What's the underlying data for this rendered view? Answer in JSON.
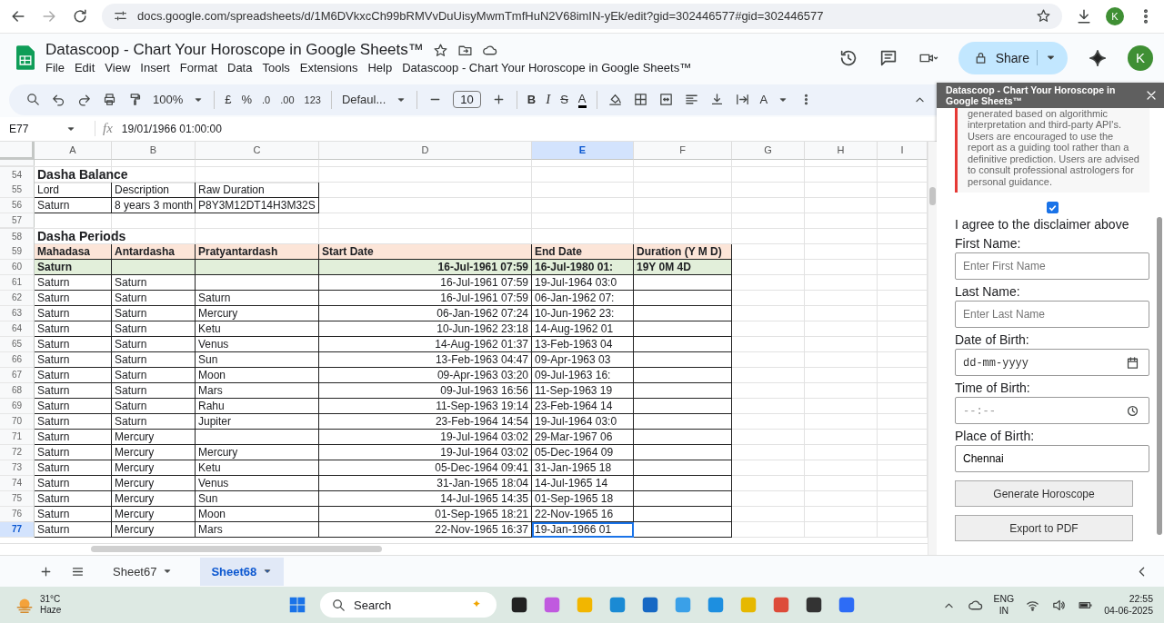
{
  "browser": {
    "url": "docs.google.com/spreadsheets/d/1M6DVkxcCh99bRMVvDuUisyMwmTmfHuN2V68imIN-yEk/edit?gid=302446577#gid=302446577",
    "avatar": "K"
  },
  "header": {
    "title": "Datascoop - Chart Your Horoscope in Google Sheets™",
    "menu": [
      "File",
      "Edit",
      "View",
      "Insert",
      "Format",
      "Data",
      "Tools",
      "Extensions",
      "Help",
      "Datascoop - Chart Your Horoscope in Google Sheets™"
    ],
    "share": "Share",
    "avatar": "K"
  },
  "toolbar": {
    "zoom": "100%",
    "currency": "£",
    "percent": "%",
    "decrease_decimal": ".0",
    "increase_decimal": ".00",
    "number_format": "123",
    "font": "Defaul...",
    "font_size": "10",
    "bold": "B",
    "italic": "I",
    "strikethrough": "S",
    "text_color": "A",
    "text_rotation": "A"
  },
  "formula_bar": {
    "cell": "E77",
    "function_label": "fx",
    "value": "19/01/1966 01:00:00"
  },
  "sheet": {
    "columns": [
      {
        "label": "A",
        "selected": false
      },
      {
        "label": "B",
        "selected": false
      },
      {
        "label": "C",
        "selected": false
      },
      {
        "label": "D",
        "selected": false
      },
      {
        "label": "E",
        "selected": true
      },
      {
        "label": "F",
        "selected": false
      },
      {
        "label": "G",
        "selected": false
      },
      {
        "label": "H",
        "selected": false
      },
      {
        "label": "I",
        "selected": false
      }
    ],
    "rows": [
      {
        "number": "54",
        "kind": "title",
        "selected": false,
        "cells": [
          "Dasha Balance"
        ]
      },
      {
        "number": "55",
        "kind": "balance",
        "selected": false,
        "cells": [
          "Lord",
          "Description",
          "Raw Duration"
        ]
      },
      {
        "number": "56",
        "kind": "balance",
        "selected": false,
        "cells": [
          "Saturn",
          "8 years 3 month",
          "P8Y3M12DT14H3M32S"
        ]
      },
      {
        "number": "57",
        "kind": "empty",
        "selected": false,
        "cells": []
      },
      {
        "number": "58",
        "kind": "title",
        "selected": false,
        "cells": [
          "Dasha Periods"
        ]
      },
      {
        "number": "59",
        "kind": "table-header",
        "selected": false,
        "cells": [
          "Mahadasa",
          "Antardasha",
          "Pratyantardash",
          "Start Date",
          "End Date",
          "Duration (Y M D)"
        ]
      },
      {
        "number": "60",
        "kind": "mahadasa",
        "selected": false,
        "cells": [
          "Saturn",
          null,
          null,
          "16-Jul-1961 07:59",
          "16-Jul-1980 01:",
          "19Y 0M 4D"
        ]
      },
      {
        "number": "61",
        "kind": "period",
        "selected": false,
        "cells": [
          "Saturn",
          "Saturn",
          null,
          "16-Jul-1961 07:59",
          "19-Jul-1964 03:0"
        ]
      },
      {
        "number": "62",
        "kind": "period",
        "selected": false,
        "cells": [
          "Saturn",
          "Saturn",
          "Saturn",
          "16-Jul-1961 07:59",
          "06-Jan-1962 07:"
        ]
      },
      {
        "number": "63",
        "kind": "period",
        "selected": false,
        "cells": [
          "Saturn",
          "Saturn",
          "Mercury",
          "06-Jan-1962 07:24",
          "10-Jun-1962 23:"
        ]
      },
      {
        "number": "64",
        "kind": "period",
        "selected": false,
        "cells": [
          "Saturn",
          "Saturn",
          "Ketu",
          "10-Jun-1962 23:18",
          "14-Aug-1962 01"
        ]
      },
      {
        "number": "65",
        "kind": "period",
        "selected": false,
        "cells": [
          "Saturn",
          "Saturn",
          "Venus",
          "14-Aug-1962 01:37",
          "13-Feb-1963 04"
        ]
      },
      {
        "number": "66",
        "kind": "period",
        "selected": false,
        "cells": [
          "Saturn",
          "Saturn",
          "Sun",
          "13-Feb-1963 04:47",
          "09-Apr-1963 03"
        ]
      },
      {
        "number": "67",
        "kind": "period",
        "selected": false,
        "cells": [
          "Saturn",
          "Saturn",
          "Moon",
          "09-Apr-1963 03:20",
          "09-Jul-1963 16:"
        ]
      },
      {
        "number": "68",
        "kind": "period",
        "selected": false,
        "cells": [
          "Saturn",
          "Saturn",
          "Mars",
          "09-Jul-1963 16:56",
          "11-Sep-1963 19"
        ]
      },
      {
        "number": "69",
        "kind": "period",
        "selected": false,
        "cells": [
          "Saturn",
          "Saturn",
          "Rahu",
          "11-Sep-1963 19:14",
          "23-Feb-1964 14"
        ]
      },
      {
        "number": "70",
        "kind": "period",
        "selected": false,
        "cells": [
          "Saturn",
          "Saturn",
          "Jupiter",
          "23-Feb-1964 14:54",
          "19-Jul-1964 03:0"
        ]
      },
      {
        "number": "71",
        "kind": "period",
        "selected": false,
        "cells": [
          "Saturn",
          "Mercury",
          null,
          "19-Jul-1964 03:02",
          "29-Mar-1967 06"
        ]
      },
      {
        "number": "72",
        "kind": "period",
        "selected": false,
        "cells": [
          "Saturn",
          "Mercury",
          "Mercury",
          "19-Jul-1964 03:02",
          "05-Dec-1964 09"
        ]
      },
      {
        "number": "73",
        "kind": "period",
        "selected": false,
        "cells": [
          "Saturn",
          "Mercury",
          "Ketu",
          "05-Dec-1964 09:41",
          "31-Jan-1965 18"
        ]
      },
      {
        "number": "74",
        "kind": "period",
        "selected": false,
        "cells": [
          "Saturn",
          "Mercury",
          "Venus",
          "31-Jan-1965 18:04",
          "14-Jul-1965 14"
        ]
      },
      {
        "number": "75",
        "kind": "period",
        "selected": false,
        "cells": [
          "Saturn",
          "Mercury",
          "Sun",
          "14-Jul-1965 14:35",
          "01-Sep-1965 18"
        ]
      },
      {
        "number": "76",
        "kind": "period",
        "selected": false,
        "cells": [
          "Saturn",
          "Mercury",
          "Moon",
          "01-Sep-1965 18:21",
          "22-Nov-1965 16"
        ]
      },
      {
        "number": "77",
        "kind": "period",
        "selected": true,
        "cells": [
          "Saturn",
          "Mercury",
          "Mars",
          "22-Nov-1965 16:37",
          "19-Jan-1966 01"
        ]
      }
    ]
  },
  "panel": {
    "title": "Datascoop - Chart Your Horoscope in Google Sheets™",
    "disclaimer": "generated based on algorithmic interpretation and third-party API's. Users are encouraged to use the report as a guiding tool rather than a definitive prediction. Users are advised to consult professional astrologers for personal guidance.",
    "agree": {
      "checked": true,
      "label": "I agree to the disclaimer above"
    },
    "fields": [
      {
        "kind": "text",
        "label": "First Name:",
        "placeholder": "Enter First Name"
      },
      {
        "kind": "text",
        "label": "Last Name:",
        "placeholder": "Enter Last Name"
      },
      {
        "kind": "date",
        "label": "Date of Birth:",
        "placeholder": "dd-mm-yyyy"
      },
      {
        "kind": "time",
        "label": "Time of Birth:",
        "placeholder": "--:--"
      },
      {
        "kind": "text",
        "label": "Place of Birth:",
        "value": "Chennai"
      }
    ],
    "buttons": [
      "Generate Horoscope",
      "Export to PDF"
    ]
  },
  "sheet_tabs": [
    {
      "label": "Sheet67",
      "selected": false
    },
    {
      "label": "Sheet68",
      "selected": true
    }
  ],
  "taskbar": {
    "temperature": "31°C",
    "condition": "Haze",
    "search": "Search",
    "language": "ENG",
    "region": "IN",
    "time": "22:55",
    "date": "04-06-2025"
  }
}
